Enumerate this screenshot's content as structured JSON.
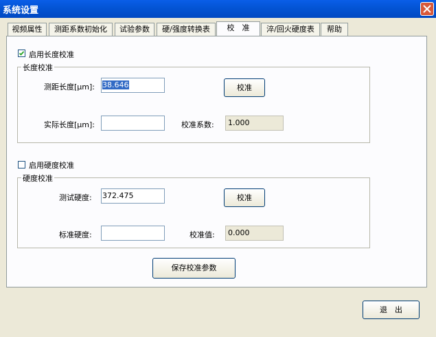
{
  "window": {
    "title": "系统设置"
  },
  "tabs": [
    {
      "label": "视频属性"
    },
    {
      "label": "测距系数初始化"
    },
    {
      "label": "试验参数"
    },
    {
      "label": "硬/强度转换表"
    },
    {
      "label": "校　准"
    },
    {
      "label": "淬/回火硬度表"
    },
    {
      "label": "帮助"
    }
  ],
  "length": {
    "enable_label": "启用长度校准",
    "enabled": true,
    "group_label": "长度校准",
    "measured_label": "测距长度[μm]:",
    "measured_value": "38.646",
    "actual_label": "实际长度[μm]:",
    "actual_value": "",
    "calibrate_button": "校准",
    "coef_label": "校准系数:",
    "coef_value": "1.000"
  },
  "hardness": {
    "enable_label": "启用硬度校准",
    "enabled": false,
    "group_label": "硬度校准",
    "test_label": "测试硬度:",
    "test_value": "372.475",
    "standard_label": "标准硬度:",
    "standard_value": "",
    "calibrate_button": "校准",
    "value_label": "校准值:",
    "value_value": "0.000"
  },
  "save_button": "保存校准参数",
  "exit_button": "退　出"
}
